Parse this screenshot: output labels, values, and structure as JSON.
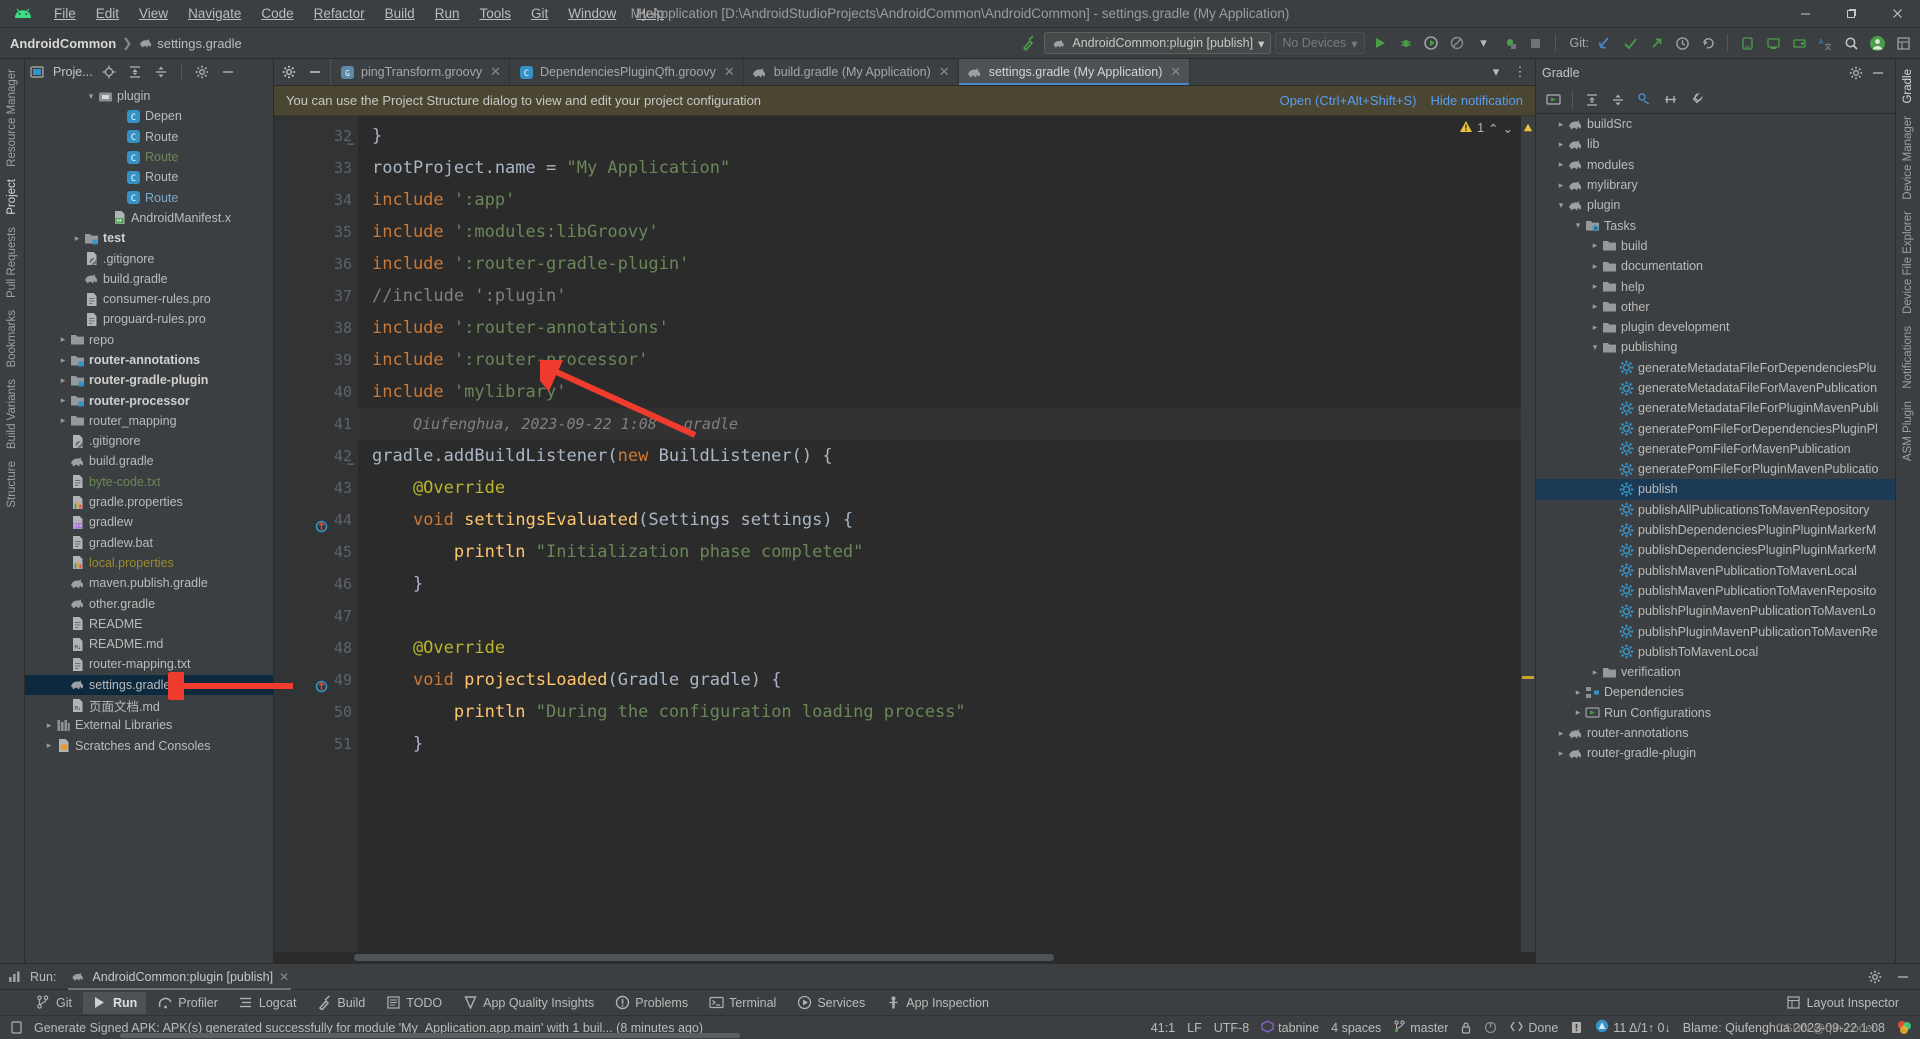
{
  "window": {
    "title": "My Application [D:\\AndroidStudioProjects\\AndroidCommon\\AndroidCommon] - settings.gradle (My Application)",
    "minimize": "—",
    "maximize": "❐",
    "close": "✕"
  },
  "menu": [
    "File",
    "Edit",
    "View",
    "Navigate",
    "Code",
    "Refactor",
    "Build",
    "Run",
    "Tools",
    "Git",
    "Window",
    "Help"
  ],
  "breadcrumb": {
    "project": "AndroidCommon",
    "separator": "❯",
    "file": "settings.gradle"
  },
  "toolbar": {
    "run_config": "AndroidCommon:plugin [publish]",
    "devices": "No Devices",
    "git_label": "Git:",
    "icons": [
      "build-hammer-icon",
      "run-icon",
      "debug-icon",
      "coverage-icon",
      "profile-icon",
      "attach-debugger-icon",
      "stop-icon",
      "git-update-icon",
      "git-commit-icon",
      "git-push-icon",
      "history-icon",
      "undo-icon",
      "device-manager-icon",
      "avd-icon",
      "sdk-icon",
      "translate-icon",
      "search-icon",
      "account-icon",
      "layout-icon"
    ]
  },
  "project_panel": {
    "title": "Proje...",
    "tools": [
      "locate-icon",
      "expand-all-icon",
      "collapse-all-icon",
      "settings-gear-icon",
      "hide-icon"
    ],
    "tree": [
      {
        "indent": 4,
        "arrow": "down",
        "icon": "module-icon",
        "label": "plugin",
        "style": "",
        "partial": true
      },
      {
        "indent": 6,
        "arrow": "",
        "icon": "class-icon",
        "label": "Depen",
        "style": "",
        "clipped": true
      },
      {
        "indent": 6,
        "arrow": "",
        "icon": "class-icon",
        "label": "Route",
        "style": "",
        "clipped": true
      },
      {
        "indent": 6,
        "arrow": "",
        "icon": "class-icon",
        "label": "Route",
        "style": "green",
        "clipped": true
      },
      {
        "indent": 6,
        "arrow": "",
        "icon": "class-icon",
        "label": "Route",
        "style": "",
        "clipped": true
      },
      {
        "indent": 6,
        "arrow": "",
        "icon": "class-icon",
        "label": "Route",
        "style": "blue",
        "clipped": true
      },
      {
        "indent": 5,
        "arrow": "",
        "icon": "manifest-icon",
        "label": "AndroidManifest.x",
        "style": "",
        "clipped": true
      },
      {
        "indent": 3,
        "arrow": "right",
        "icon": "test-folder-icon",
        "label": "test",
        "style": "bold"
      },
      {
        "indent": 3,
        "arrow": "",
        "icon": "gitignore-icon",
        "label": ".gitignore",
        "style": ""
      },
      {
        "indent": 3,
        "arrow": "",
        "icon": "gradle-icon",
        "label": "build.gradle",
        "style": ""
      },
      {
        "indent": 3,
        "arrow": "",
        "icon": "text-icon",
        "label": "consumer-rules.pro",
        "style": ""
      },
      {
        "indent": 3,
        "arrow": "",
        "icon": "text-icon",
        "label": "proguard-rules.pro",
        "style": ""
      },
      {
        "indent": 2,
        "arrow": "right",
        "icon": "folder-icon",
        "label": "repo",
        "style": ""
      },
      {
        "indent": 2,
        "arrow": "right",
        "icon": "module-folder-icon",
        "label": "router-annotations",
        "style": "bold"
      },
      {
        "indent": 2,
        "arrow": "right",
        "icon": "module-folder-icon",
        "label": "router-gradle-plugin",
        "style": "bold"
      },
      {
        "indent": 2,
        "arrow": "right",
        "icon": "module-folder-icon",
        "label": "router-processor",
        "style": "bold"
      },
      {
        "indent": 2,
        "arrow": "right",
        "icon": "folder-icon",
        "label": "router_mapping",
        "style": ""
      },
      {
        "indent": 2,
        "arrow": "",
        "icon": "gitignore-icon",
        "label": ".gitignore",
        "style": ""
      },
      {
        "indent": 2,
        "arrow": "",
        "icon": "gradle-icon",
        "label": "build.gradle",
        "style": ""
      },
      {
        "indent": 2,
        "arrow": "",
        "icon": "text-icon",
        "label": "byte-code.txt",
        "style": "green"
      },
      {
        "indent": 2,
        "arrow": "",
        "icon": "properties-icon",
        "label": "gradle.properties",
        "style": ""
      },
      {
        "indent": 2,
        "arrow": "",
        "icon": "cpp-icon",
        "label": "gradlew",
        "style": ""
      },
      {
        "indent": 2,
        "arrow": "",
        "icon": "text-icon",
        "label": "gradlew.bat",
        "style": ""
      },
      {
        "indent": 2,
        "arrow": "",
        "icon": "properties-icon",
        "label": "local.properties",
        "style": "olive"
      },
      {
        "indent": 2,
        "arrow": "",
        "icon": "gradle-icon",
        "label": "maven.publish.gradle",
        "style": ""
      },
      {
        "indent": 2,
        "arrow": "",
        "icon": "gradle-icon",
        "label": "other.gradle",
        "style": ""
      },
      {
        "indent": 2,
        "arrow": "",
        "icon": "text-icon",
        "label": "README",
        "style": ""
      },
      {
        "indent": 2,
        "arrow": "",
        "icon": "markdown-icon",
        "label": "README.md",
        "style": ""
      },
      {
        "indent": 2,
        "arrow": "",
        "icon": "text-icon",
        "label": "router-mapping.txt",
        "style": ""
      },
      {
        "indent": 2,
        "arrow": "",
        "icon": "gradle-icon",
        "label": "settings.gradle",
        "style": "",
        "selected": true
      },
      {
        "indent": 2,
        "arrow": "",
        "icon": "markdown-icon",
        "label": "页面文档.md",
        "style": ""
      },
      {
        "indent": 1,
        "arrow": "right",
        "icon": "library-icon",
        "label": "External Libraries",
        "style": ""
      },
      {
        "indent": 1,
        "arrow": "right",
        "icon": "scratch-icon",
        "label": "Scratches and Consoles",
        "style": ""
      }
    ]
  },
  "left_strip": [
    "Resource Manager",
    "Project",
    "Pull Requests",
    "Bookmarks",
    "Build Variants",
    "Structure"
  ],
  "right_strip": [
    "Gradle",
    "Device Manager",
    "Device File Explorer",
    "Notifications",
    "ASM Plugin"
  ],
  "editor": {
    "tabs": [
      {
        "label": "pingTransform.groovy",
        "icon": "groovy-file-icon",
        "active": false,
        "clipped": true
      },
      {
        "label": "DependenciesPluginQfh.groovy",
        "icon": "class-icon",
        "active": false
      },
      {
        "label": "build.gradle (My Application)",
        "icon": "gradle-icon",
        "active": false
      },
      {
        "label": "settings.gradle (My Application)",
        "icon": "gradle-icon",
        "active": true
      }
    ],
    "notification": {
      "text": "You can use the Project Structure dialog to view and edit your project configuration",
      "open_link": "Open (Ctrl+Alt+Shift+S)",
      "hide_link": "Hide notification"
    },
    "warning_count": "1",
    "lines": [
      {
        "n": "32",
        "text": "}",
        "fold": true,
        "current": false
      },
      {
        "n": "33",
        "text": "rootProject.name = \"My Application\"",
        "current": false
      },
      {
        "n": "34",
        "text": "include ':app'",
        "current": false
      },
      {
        "n": "35",
        "text": "include ':modules:libGroovy'",
        "current": false
      },
      {
        "n": "36",
        "text": "include ':router-gradle-plugin'",
        "current": false
      },
      {
        "n": "37",
        "text": "//include ':plugin'",
        "current": false
      },
      {
        "n": "38",
        "text": "include ':router-annotations'",
        "current": false
      },
      {
        "n": "39",
        "text": "include ':router-processor'",
        "current": false
      },
      {
        "n": "40",
        "text": "include 'mylibrary'",
        "current": false
      },
      {
        "n": "41",
        "text": "",
        "current": true,
        "hint": "Qiufenghua, 2023-09-22 1:08 • gradle"
      },
      {
        "n": "42",
        "text": "gradle.addBuildListener(new BuildListener() {",
        "fold": true,
        "current": false
      },
      {
        "n": "43",
        "text": "    @Override",
        "current": false
      },
      {
        "n": "44",
        "text": "    void settingsEvaluated(Settings settings) {",
        "current": false,
        "gutter_mark": "override-icon"
      },
      {
        "n": "45",
        "text": "        println \"Initialization phase completed\"",
        "current": false
      },
      {
        "n": "46",
        "text": "    }",
        "current": false
      },
      {
        "n": "47",
        "text": "",
        "current": false
      },
      {
        "n": "48",
        "text": "    @Override",
        "current": false
      },
      {
        "n": "49",
        "text": "    void projectsLoaded(Gradle gradle) {",
        "current": false,
        "gutter_mark": "override-icon"
      },
      {
        "n": "50",
        "text": "        println \"During the configuration loading process\"",
        "current": false
      },
      {
        "n": "51",
        "text": "    }",
        "current": false
      }
    ]
  },
  "gradle_panel": {
    "title": "Gradle",
    "toolbar_icons": [
      "execute-task-icon",
      "expand-all-icon",
      "collapse-all-icon",
      "link-project-icon",
      "toggle-offline-icon",
      "build-tool-settings-icon"
    ],
    "header_icons": [
      "settings-gear-icon",
      "hide-icon"
    ],
    "tree": [
      {
        "indent": 1,
        "arrow": "right",
        "icon": "gradle-icon",
        "label": "buildSrc"
      },
      {
        "indent": 1,
        "arrow": "right",
        "icon": "gradle-icon",
        "label": "lib"
      },
      {
        "indent": 1,
        "arrow": "right",
        "icon": "gradle-icon",
        "label": "modules"
      },
      {
        "indent": 1,
        "arrow": "right",
        "icon": "gradle-icon",
        "label": "mylibrary"
      },
      {
        "indent": 1,
        "arrow": "down",
        "icon": "gradle-icon",
        "label": "plugin"
      },
      {
        "indent": 2,
        "arrow": "down",
        "icon": "tasks-folder-icon",
        "label": "Tasks"
      },
      {
        "indent": 3,
        "arrow": "right",
        "icon": "folder-icon",
        "label": "build"
      },
      {
        "indent": 3,
        "arrow": "right",
        "icon": "folder-icon",
        "label": "documentation"
      },
      {
        "indent": 3,
        "arrow": "right",
        "icon": "folder-icon",
        "label": "help"
      },
      {
        "indent": 3,
        "arrow": "right",
        "icon": "folder-icon",
        "label": "other"
      },
      {
        "indent": 3,
        "arrow": "right",
        "icon": "folder-icon",
        "label": "plugin development"
      },
      {
        "indent": 3,
        "arrow": "down",
        "icon": "folder-icon",
        "label": "publishing"
      },
      {
        "indent": 4,
        "arrow": "",
        "icon": "task-gear-icon",
        "label": "generateMetadataFileForDependenciesPlu",
        "clipped": true
      },
      {
        "indent": 4,
        "arrow": "",
        "icon": "task-gear-icon",
        "label": "generateMetadataFileForMavenPublication",
        "clipped": true
      },
      {
        "indent": 4,
        "arrow": "",
        "icon": "task-gear-icon",
        "label": "generateMetadataFileForPluginMavenPubli",
        "clipped": true
      },
      {
        "indent": 4,
        "arrow": "",
        "icon": "task-gear-icon",
        "label": "generatePomFileForDependenciesPluginPl",
        "clipped": true
      },
      {
        "indent": 4,
        "arrow": "",
        "icon": "task-gear-icon",
        "label": "generatePomFileForMavenPublication"
      },
      {
        "indent": 4,
        "arrow": "",
        "icon": "task-gear-icon",
        "label": "generatePomFileForPluginMavenPublicatio",
        "clipped": true
      },
      {
        "indent": 4,
        "arrow": "",
        "icon": "task-gear-icon",
        "label": "publish",
        "selected": true
      },
      {
        "indent": 4,
        "arrow": "",
        "icon": "task-gear-icon",
        "label": "publishAllPublicationsToMavenRepository",
        "clipped": true
      },
      {
        "indent": 4,
        "arrow": "",
        "icon": "task-gear-icon",
        "label": "publishDependenciesPluginPluginMarkerM",
        "clipped": true
      },
      {
        "indent": 4,
        "arrow": "",
        "icon": "task-gear-icon",
        "label": "publishDependenciesPluginPluginMarkerM",
        "clipped": true
      },
      {
        "indent": 4,
        "arrow": "",
        "icon": "task-gear-icon",
        "label": "publishMavenPublicationToMavenLocal"
      },
      {
        "indent": 4,
        "arrow": "",
        "icon": "task-gear-icon",
        "label": "publishMavenPublicationToMavenReposito",
        "clipped": true
      },
      {
        "indent": 4,
        "arrow": "",
        "icon": "task-gear-icon",
        "label": "publishPluginMavenPublicationToMavenLo",
        "clipped": true
      },
      {
        "indent": 4,
        "arrow": "",
        "icon": "task-gear-icon",
        "label": "publishPluginMavenPublicationToMavenRe",
        "clipped": true
      },
      {
        "indent": 4,
        "arrow": "",
        "icon": "task-gear-icon",
        "label": "publishToMavenLocal"
      },
      {
        "indent": 3,
        "arrow": "right",
        "icon": "folder-icon",
        "label": "verification"
      },
      {
        "indent": 2,
        "arrow": "right",
        "icon": "dependencies-icon",
        "label": "Dependencies"
      },
      {
        "indent": 2,
        "arrow": "right",
        "icon": "run-config-icon",
        "label": "Run Configurations"
      },
      {
        "indent": 1,
        "arrow": "right",
        "icon": "gradle-icon",
        "label": "router-annotations"
      },
      {
        "indent": 1,
        "arrow": "right",
        "icon": "gradle-icon",
        "label": "router-gradle-plugin"
      }
    ]
  },
  "run_panel": {
    "label": "Run:",
    "config": "AndroidCommon:plugin [publish]",
    "close": "✕"
  },
  "bottom_tabs": [
    {
      "label": "Git",
      "icon": "git-branch-icon",
      "active": false
    },
    {
      "label": "Run",
      "icon": "run-icon",
      "active": true
    },
    {
      "label": "Profiler",
      "icon": "profiler-icon",
      "active": false
    },
    {
      "label": "Logcat",
      "icon": "logcat-icon",
      "active": false
    },
    {
      "label": "Build",
      "icon": "build-hammer-icon",
      "active": false
    },
    {
      "label": "TODO",
      "icon": "todo-icon",
      "active": false
    },
    {
      "label": "App Quality Insights",
      "icon": "insights-icon",
      "active": false
    },
    {
      "label": "Problems",
      "icon": "problems-icon",
      "active": false
    },
    {
      "label": "Terminal",
      "icon": "terminal-icon",
      "active": false
    },
    {
      "label": "Services",
      "icon": "services-icon",
      "active": false
    },
    {
      "label": "App Inspection",
      "icon": "app-inspection-icon",
      "active": false
    }
  ],
  "bottom_right": {
    "layout_inspector": "Layout Inspector",
    "icon": "layout-inspector-icon"
  },
  "statusbar": {
    "message": "Generate Signed APK: APK(s) generated successfully for module 'My_Application.app.main' with 1 buil... (8 minutes ago)",
    "caret": "41:1",
    "line_sep": "LF",
    "encoding": "UTF-8",
    "tabnine": "tabnine",
    "indent": "4 spaces",
    "branch": "master",
    "inspection": "Done",
    "vcs_stats": "11 Δ/1↑ 0↓",
    "blame": "Blame: Qiufenghua 2023-09-22 1:08"
  },
  "watermark": "CSDN @qfh-coder",
  "colors": {
    "accent_blue": "#4a88c7",
    "link_blue": "#589df6",
    "selection_blue": "#0d293e",
    "gradle_selection": "#1b3a55",
    "notif_bg": "#4b4632",
    "green": "#6a8759",
    "orange_kw": "#cc7832",
    "annotation_red": "#f03c2e"
  }
}
